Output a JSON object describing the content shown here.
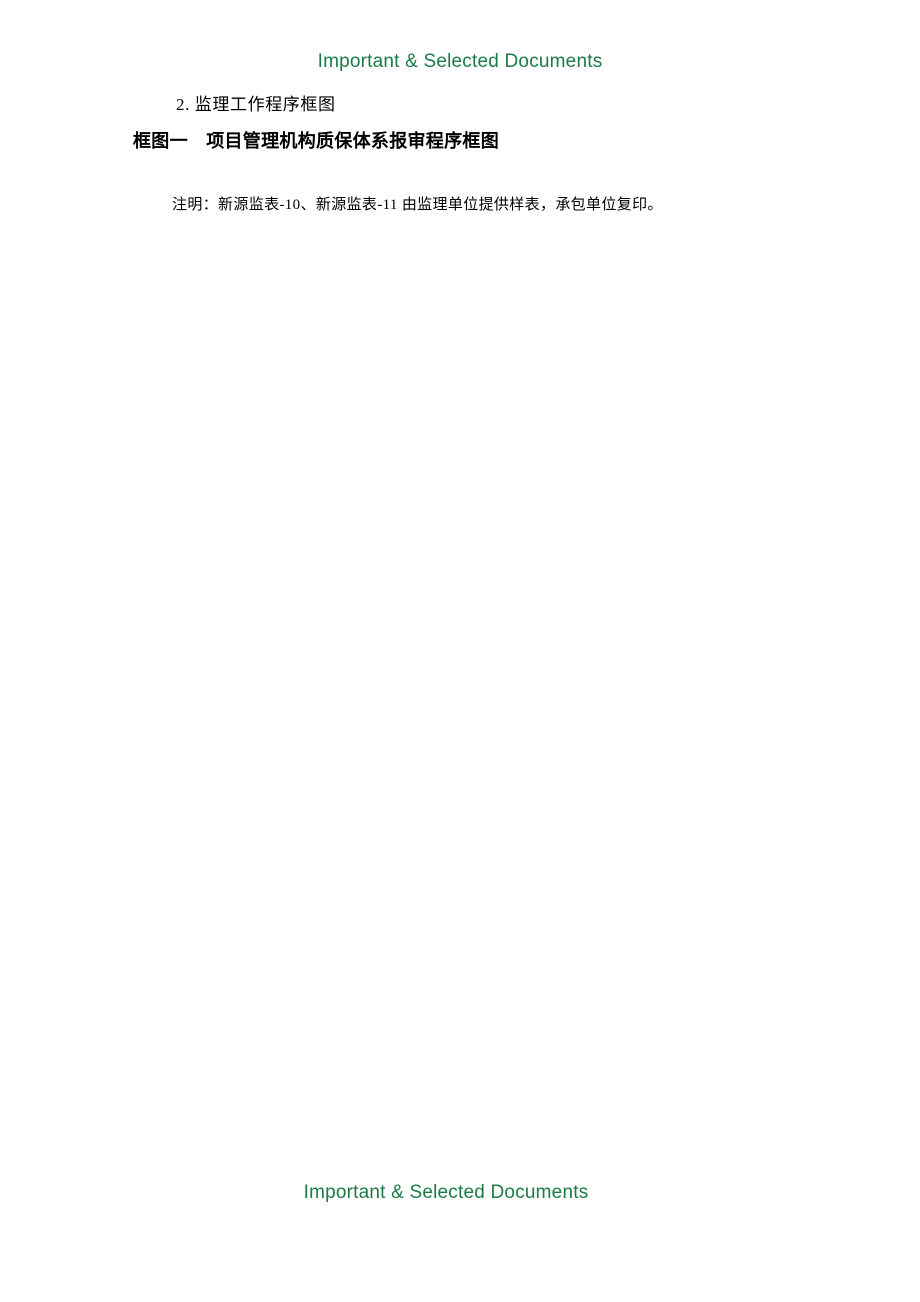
{
  "page": {
    "background_color": "#ffffff",
    "text_color": "#000000",
    "accent_color": "#1B7B46"
  },
  "header": {
    "text": "Important & Selected Documents"
  },
  "body": {
    "section_label": "2. 监理工作程序框图",
    "chart_title": "框图一　项目管理机构质保体系报审程序框图",
    "note": "注明：新源监表-10、新源监表-11 由监理单位提供样表，承包单位复印。"
  },
  "footer": {
    "text": "Important & Selected Documents"
  }
}
